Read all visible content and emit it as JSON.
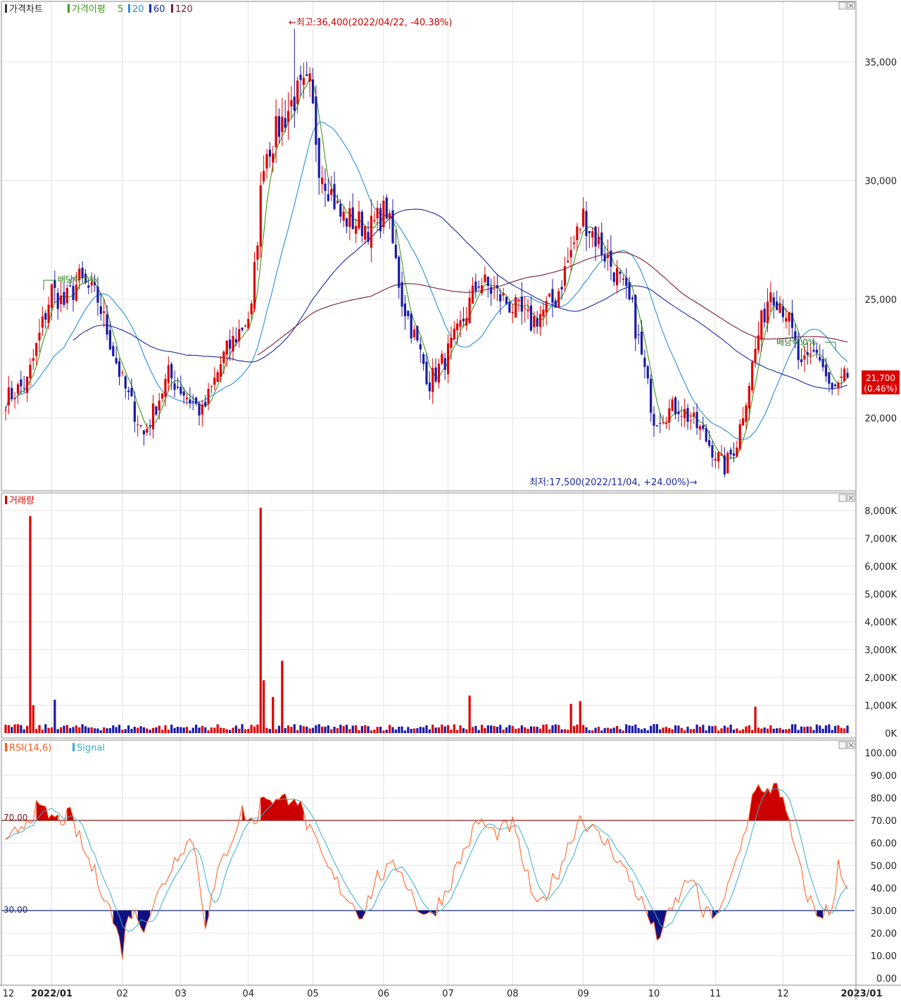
{
  "colors": {
    "up": "#dd0000",
    "down": "#1a1aa6",
    "ma5": "#3a9a1a",
    "ma20": "#2a8fd8",
    "ma60": "#1a2aa0",
    "ma120": "#7a1a3a",
    "rsi": "#ff5a1a",
    "signal": "#3ab0c8",
    "grid": "#e4e4e4",
    "panel_border": "#8a8a8a"
  },
  "price_panel": {
    "title": "가격차트",
    "ma_title": "가격이평",
    "ma_periods": [
      "5",
      "20",
      "60",
      "120"
    ],
    "high_annotation": "←최고:36,400(2022/04/22, -40.38%)",
    "low_annotation": "최저:17,500(2022/11/04, +24.00%)→",
    "dividend_left": "배당락:0%",
    "dividend_right": "배당락:0%",
    "last_price": "21,700",
    "last_change": "(0.46%)"
  },
  "volume_panel": {
    "title": "거래량"
  },
  "rsi_panel": {
    "title": "RSI(14,6)",
    "signal_title": "Signal",
    "upper_label": "70.00",
    "lower_label": "30.00"
  },
  "x_axis": {
    "labels": [
      "12",
      "2022/01",
      "02",
      "03",
      "04",
      "05",
      "06",
      "07",
      "08",
      "09",
      "10",
      "11",
      "12",
      "2023/01"
    ]
  },
  "chart_data": [
    {
      "type": "candlestick",
      "title": "가격차트",
      "y_ticks": [
        "35,000",
        "30,000",
        "25,000",
        "20,000"
      ],
      "ylim": [
        17000,
        36500
      ],
      "grid": true,
      "series_names": [
        "가격이평 5",
        "20",
        "60",
        "120"
      ],
      "anchor_points": [
        [
          "2021-12-13",
          20800
        ],
        [
          "2021-12-22",
          21500
        ],
        [
          "2022-01-03",
          25400
        ],
        [
          "2022-01-07",
          24800
        ],
        [
          "2022-01-14",
          25800
        ],
        [
          "2022-01-24",
          25000
        ],
        [
          "2022-02-03",
          21500
        ],
        [
          "2022-02-14",
          19300
        ],
        [
          "2022-02-24",
          21800
        ],
        [
          "2022-03-11",
          20200
        ],
        [
          "2022-03-22",
          22600
        ],
        [
          "2022-04-04",
          24500
        ],
        [
          "2022-04-08",
          31000
        ],
        [
          "2022-04-22",
          33500
        ],
        [
          "2022-04-29",
          33900
        ],
        [
          "2022-05-04",
          30800
        ],
        [
          "2022-05-13",
          28500
        ],
        [
          "2022-05-27",
          28000
        ],
        [
          "2022-06-03",
          28800
        ],
        [
          "2022-06-10",
          25000
        ],
        [
          "2022-06-23",
          21500
        ],
        [
          "2022-06-30",
          22500
        ],
        [
          "2022-07-06",
          23500
        ],
        [
          "2022-07-15",
          25800
        ],
        [
          "2022-07-27",
          25000
        ],
        [
          "2022-08-09",
          24000
        ],
        [
          "2022-08-19",
          25000
        ],
        [
          "2022-08-26",
          27000
        ],
        [
          "2022-09-01",
          28500
        ],
        [
          "2022-09-16",
          26000
        ],
        [
          "2022-09-23",
          24500
        ],
        [
          "2022-10-04",
          20000
        ],
        [
          "2022-10-14",
          20500
        ],
        [
          "2022-10-25",
          19500
        ],
        [
          "2022-11-04",
          17900
        ],
        [
          "2022-11-10",
          19000
        ],
        [
          "2022-11-21",
          23500
        ],
        [
          "2022-11-25",
          25500
        ],
        [
          "2022-12-02",
          24500
        ],
        [
          "2022-12-09",
          22000
        ],
        [
          "2022-12-16",
          22900
        ],
        [
          "2022-12-23",
          21000
        ],
        [
          "2022-12-29",
          21700
        ]
      ],
      "high": {
        "value": 36400,
        "date": "2022-04-22"
      },
      "low": {
        "value": 17500,
        "date": "2022-11-04"
      },
      "last": 21700
    },
    {
      "type": "bar",
      "title": "거래량",
      "y_ticks": [
        "8,000K",
        "7,000K",
        "6,000K",
        "5,000K",
        "4,000K",
        "3,000K",
        "2,000K",
        "1,000K",
        "0K"
      ],
      "ylim": [
        0,
        8000
      ],
      "unit": "K",
      "spikes": [
        [
          "2021-12-23",
          7800
        ],
        [
          "2021-12-24",
          1000
        ],
        [
          "2022-01-04",
          1200
        ],
        [
          "2022-04-07",
          8100
        ],
        [
          "2022-04-08",
          1900
        ],
        [
          "2022-04-13",
          1300
        ],
        [
          "2022-04-18",
          2600
        ],
        [
          "2022-07-12",
          1350
        ],
        [
          "2022-08-26",
          1050
        ],
        [
          "2022-08-31",
          1150
        ],
        [
          "2022-11-18",
          950
        ]
      ],
      "base_level": 260
    },
    {
      "type": "line",
      "title": "RSI(14,6)",
      "series_names": [
        "RSI(14,6)",
        "Signal"
      ],
      "y_ticks": [
        "100.00",
        "90.00",
        "80.00",
        "70.00",
        "60.00",
        "50.00",
        "40.00",
        "30.00",
        "20.00",
        "10.00",
        "0.00"
      ],
      "ylim": [
        0,
        100
      ],
      "thresholds": [
        70,
        30
      ],
      "anchor_points": [
        [
          "2021-12-13",
          58
        ],
        [
          "2021-12-20",
          68
        ],
        [
          "2021-12-27",
          75
        ],
        [
          "2022-01-05",
          70
        ],
        [
          "2022-01-11",
          72
        ],
        [
          "2022-01-18",
          55
        ],
        [
          "2022-01-27",
          35
        ],
        [
          "2022-02-03",
          12
        ],
        [
          "2022-02-07",
          30
        ],
        [
          "2022-02-14",
          24
        ],
        [
          "2022-02-21",
          38
        ],
        [
          "2022-03-02",
          58
        ],
        [
          "2022-03-08",
          62
        ],
        [
          "2022-03-14",
          25
        ],
        [
          "2022-03-21",
          50
        ],
        [
          "2022-03-30",
          74
        ],
        [
          "2022-04-05",
          68
        ],
        [
          "2022-04-08",
          82
        ],
        [
          "2022-04-15",
          78
        ],
        [
          "2022-04-22",
          82
        ],
        [
          "2022-05-02",
          62
        ],
        [
          "2022-05-09",
          48
        ],
        [
          "2022-05-16",
          38
        ],
        [
          "2022-05-24",
          28
        ],
        [
          "2022-05-31",
          45
        ],
        [
          "2022-06-09",
          50
        ],
        [
          "2022-06-17",
          32
        ],
        [
          "2022-06-23",
          27
        ],
        [
          "2022-07-01",
          40
        ],
        [
          "2022-07-06",
          50
        ],
        [
          "2022-07-15",
          70
        ],
        [
          "2022-07-22",
          64
        ],
        [
          "2022-08-01",
          68
        ],
        [
          "2022-08-11",
          30
        ],
        [
          "2022-08-22",
          48
        ],
        [
          "2022-08-31",
          72
        ],
        [
          "2022-09-07",
          64
        ],
        [
          "2022-09-14",
          58
        ],
        [
          "2022-09-23",
          42
        ],
        [
          "2022-09-30",
          28
        ],
        [
          "2022-10-05",
          18
        ],
        [
          "2022-10-11",
          28
        ],
        [
          "2022-10-20",
          46
        ],
        [
          "2022-10-26",
          28
        ],
        [
          "2022-11-03",
          30
        ],
        [
          "2022-11-08",
          44
        ],
        [
          "2022-11-14",
          62
        ],
        [
          "2022-11-18",
          86
        ],
        [
          "2022-11-23",
          80
        ],
        [
          "2022-11-29",
          88
        ],
        [
          "2022-12-06",
          62
        ],
        [
          "2022-12-12",
          40
        ],
        [
          "2022-12-16",
          28
        ],
        [
          "2022-12-21",
          30
        ],
        [
          "2022-12-23",
          28
        ],
        [
          "2022-12-27",
          52
        ],
        [
          "2022-12-30",
          40
        ]
      ]
    }
  ]
}
